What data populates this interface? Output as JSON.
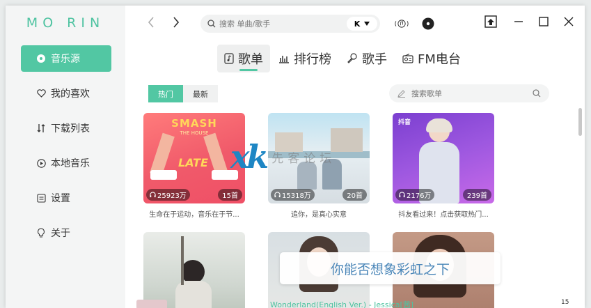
{
  "app": {
    "logo": "MO RIN"
  },
  "sidebar": {
    "items": [
      {
        "label": "音乐源",
        "icon": "music-source-icon"
      },
      {
        "label": "我的喜欢",
        "icon": "heart-icon"
      },
      {
        "label": "下载列表",
        "icon": "download-list-icon"
      },
      {
        "label": "本地音乐",
        "icon": "play-circle-icon"
      },
      {
        "label": "设置",
        "icon": "settings-icon"
      },
      {
        "label": "关于",
        "icon": "bulb-icon"
      }
    ]
  },
  "topbar": {
    "search_placeholder": "搜索 单曲/歌手",
    "source_label": "K"
  },
  "tabs": [
    {
      "label": "歌单",
      "icon": "playlist-icon"
    },
    {
      "label": "排行榜",
      "icon": "chart-icon"
    },
    {
      "label": "歌手",
      "icon": "mic-icon"
    },
    {
      "label": "FM电台",
      "icon": "radio-icon"
    }
  ],
  "filters": [
    "热门",
    "最新"
  ],
  "playlist_search_placeholder": "搜索歌单",
  "playlists": [
    {
      "plays": "25923万",
      "count": "15首",
      "desc": "生命在于运动，音乐在于节...",
      "cover_title": "SMASH",
      "cover_subtitle": "THE HOUSE",
      "cover_word": "LATE"
    },
    {
      "plays": "15318万",
      "count": "20首",
      "desc": "追你，是真心实意"
    },
    {
      "plays": "2176万",
      "count": "239首",
      "desc": "抖友看过来！点击获取热门...",
      "cover_brand": "抖音"
    },
    {
      "plays": "",
      "count": "",
      "desc": ""
    },
    {
      "plays": "",
      "count": "",
      "desc": ""
    },
    {
      "plays": "",
      "count": "",
      "desc": ""
    }
  ],
  "watermark": {
    "logo": "xk",
    "text": "先客论坛"
  },
  "lyric": "你能否想象彩虹之下",
  "bottom": {
    "song": "Wonderland(English Ver.) - Jessica[茜]",
    "time": "15"
  },
  "colors": {
    "accent": "#52c7a3"
  }
}
